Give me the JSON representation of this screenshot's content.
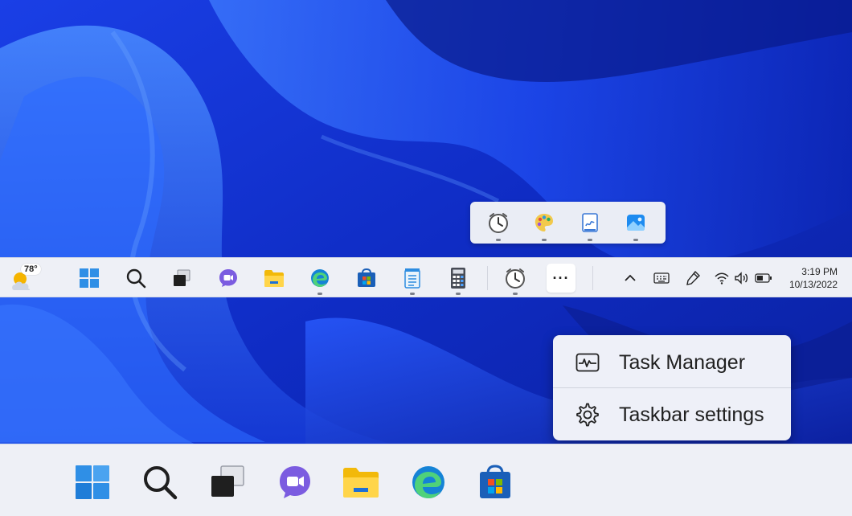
{
  "weather": {
    "temperature": "78°"
  },
  "clock": {
    "time": "3:19 PM",
    "date": "10/13/2022"
  },
  "context_menu": {
    "items": [
      {
        "label": "Task Manager",
        "icon": "task-manager-icon"
      },
      {
        "label": "Taskbar settings",
        "icon": "gear-icon"
      }
    ]
  },
  "taskbar_small": {
    "apps": [
      "start-icon",
      "search-icon",
      "task-view-icon",
      "teams-chat-icon",
      "file-explorer-icon",
      "edge-icon",
      "store-icon",
      "notepad-icon",
      "calculator-icon",
      "clock-app-icon"
    ],
    "more_label": "···"
  },
  "overflow_flyout": {
    "apps": [
      "clock-app-icon",
      "paint-icon",
      "whiteboard-icon",
      "photos-icon"
    ]
  },
  "tray": [
    "chevron-up-icon",
    "keyboard-icon",
    "pen-icon",
    "wifi-icon",
    "volume-icon",
    "battery-icon"
  ],
  "taskbar_large": {
    "apps": [
      "start-icon",
      "search-icon",
      "task-view-icon",
      "teams-chat-icon",
      "file-explorer-icon",
      "edge-icon",
      "store-icon"
    ]
  },
  "colors": {
    "wallpaper_base": "#1536d8",
    "taskbar": "#eef0f6",
    "accent": "#0a64c8"
  }
}
